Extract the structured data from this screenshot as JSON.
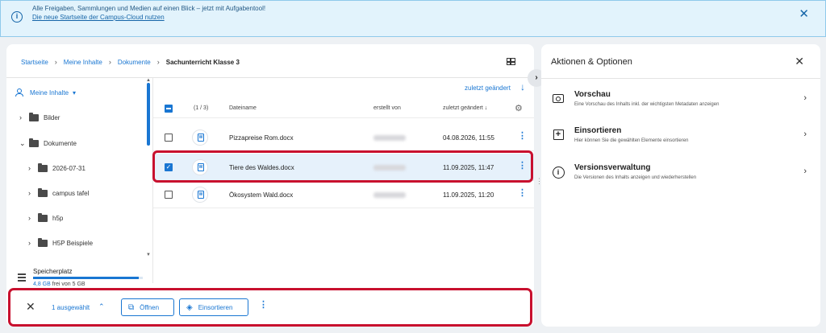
{
  "banner": {
    "message": "Alle Freigaben, Sammlungen und Medien auf einen Blick – jetzt mit Aufgabentool!",
    "link": "Die neue Startseite der Campus-Cloud nutzen",
    "close": "✕"
  },
  "breadcrumb": {
    "items": [
      "Startseite",
      "Meine Inhalte",
      "Dokumente"
    ],
    "current": "Sachunterricht Klasse 3",
    "separator": "›"
  },
  "sidebar": {
    "root": "Meine Inhalte",
    "items": [
      {
        "label": "Bilder",
        "expanded": false
      },
      {
        "label": "Dokumente",
        "expanded": true
      },
      {
        "label": "2026-07-31",
        "expanded": false
      },
      {
        "label": "campus tafel",
        "expanded": false
      },
      {
        "label": "h5p",
        "expanded": false
      },
      {
        "label": "H5P Beispiele",
        "expanded": false
      }
    ],
    "storage": {
      "title": "Speicherplatz",
      "used": "4,8 GB",
      "rest": " frei von 5 GB",
      "used_fraction": 0.96
    }
  },
  "list": {
    "sort_link": "zuletzt geändert",
    "header": {
      "count": "(1 / 3)",
      "name": "Dateiname",
      "creator": "erstellt von",
      "modified": "zuletzt geändert"
    },
    "rows": [
      {
        "name": "Pizzapreise Rom.docx",
        "modified": "04.08.2026, 11:55",
        "selected": false
      },
      {
        "name": "Tiere des Waldes.docx",
        "modified": "11.09.2025, 11:47",
        "selected": true
      },
      {
        "name": "Ökosystem Wald.docx",
        "modified": "11.09.2025, 11:20",
        "selected": false
      }
    ]
  },
  "selection_bar": {
    "count": "1 ausgewählt",
    "open_label": "Öffnen",
    "insert_label": "Einsortieren"
  },
  "panel": {
    "title": "Aktionen & Optionen",
    "actions": [
      {
        "title": "Vorschau",
        "desc": "Eine Vorschau des Inhalts inkl. der wichtigsten Metadaten anzeigen",
        "icon": "preview-icon"
      },
      {
        "title": "Einsortieren",
        "desc": "Hier können Sie die gewählten Elemente einsortieren",
        "icon": "insert-icon"
      },
      {
        "title": "Versionsverwaltung",
        "desc": "Die Versionen des Inhalts anzeigen und wiederherstellen",
        "icon": "info-icon"
      }
    ]
  },
  "colors": {
    "accent": "#1976d2",
    "highlight": "#c8102e",
    "banner_bg": "#e2f3fc"
  }
}
